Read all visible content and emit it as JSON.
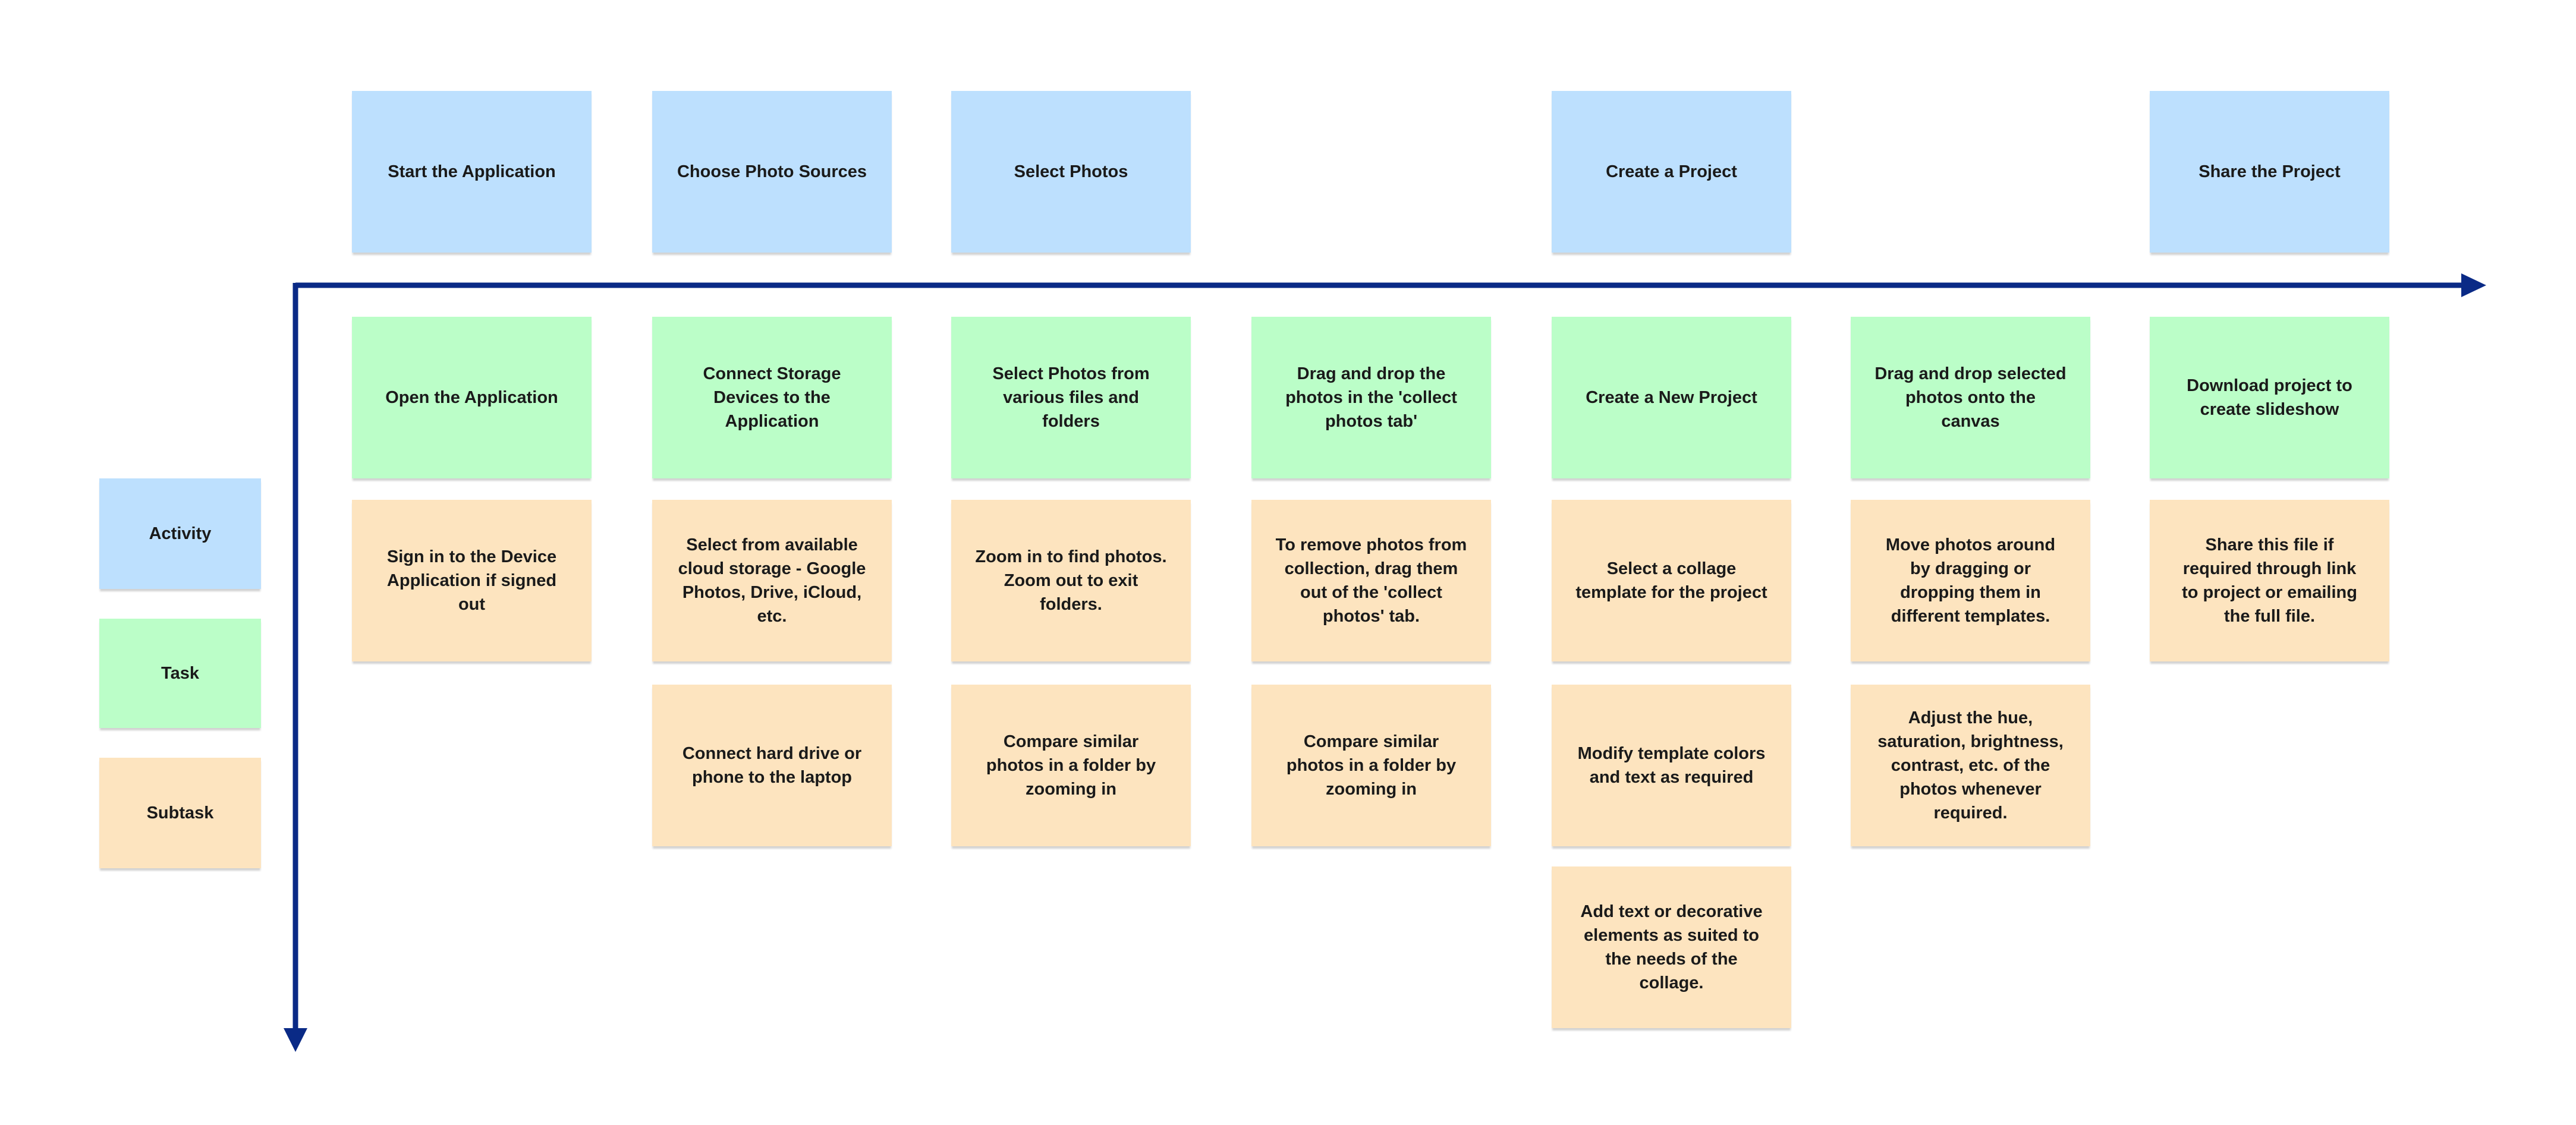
{
  "colors": {
    "activity": "#bde0fe",
    "task": "#bbfec8",
    "subtask": "#fde4bf",
    "arrow": "#0a2a86"
  },
  "legend": [
    {
      "type": "activity",
      "label": "Activity"
    },
    {
      "type": "task",
      "label": "Task"
    },
    {
      "type": "subtask",
      "label": "Subtask"
    }
  ],
  "columns": [
    {
      "activity": "Start the Application",
      "task": "Open the Application",
      "subtasks": [
        "Sign in to the Device Application if signed out"
      ]
    },
    {
      "activity": "Choose Photo Sources",
      "task": "Connect Storage Devices to the Application",
      "subtasks": [
        "Select from available cloud storage - Google Photos, Drive, iCloud, etc.",
        "Connect hard drive or phone to the laptop"
      ]
    },
    {
      "activity": "Select Photos",
      "task": "Select Photos from various files and folders",
      "subtasks": [
        "Zoom in to find photos. Zoom out to exit folders.",
        "Compare similar photos in a folder by zooming in"
      ]
    },
    {
      "activity": null,
      "task": "Drag and drop the photos in the 'collect photos tab'",
      "subtasks": [
        "To remove photos from collection, drag them out of the 'collect photos' tab.",
        "Compare similar photos in a folder by zooming in"
      ]
    },
    {
      "activity": "Create a Project",
      "task": "Create a New Project",
      "subtasks": [
        "Select a collage template for the project",
        "Modify template colors and text as required",
        "Add text or decorative elements as suited to the needs of the collage."
      ]
    },
    {
      "activity": null,
      "task": "Drag and drop selected photos onto the canvas",
      "subtasks": [
        "Move photos around by dragging or dropping them in different templates.",
        "Adjust the hue, saturation, brightness, contrast, etc. of the photos whenever required."
      ]
    },
    {
      "activity": "Share the Project",
      "task": "Download project to create slideshow",
      "subtasks": [
        "Share this file if required through link to project or emailing the full file."
      ]
    }
  ]
}
